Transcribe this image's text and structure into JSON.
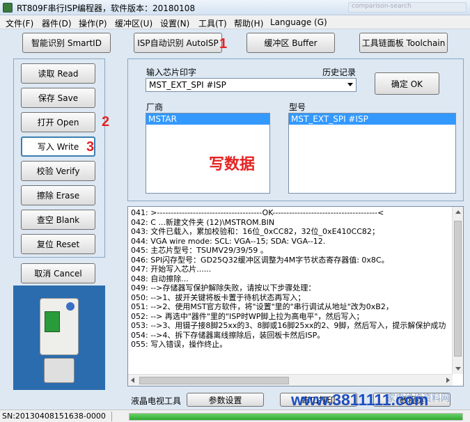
{
  "window": {
    "title": "RT809F串行ISP编程器，软件版本：20180108",
    "ghost_tab": "comparison-search"
  },
  "menu": [
    "文件(F)",
    "器件(D)",
    "操作(P)",
    "缓冲区(U)",
    "设置(N)",
    "工具(T)",
    "帮助(H)",
    "Language (G)"
  ],
  "toolbar": {
    "smartid": "智能识别 SmartID",
    "autoisp": "ISP自动识别 AutoISP",
    "buffer": "缓冲区 Buffer",
    "toolchain": "工具链面板 Toolchain"
  },
  "ops": {
    "read": "读取 Read",
    "save": "保存 Save",
    "open": "打开 Open",
    "write": "写入 Write",
    "verify": "校验 Verify",
    "erase": "擦除 Erase",
    "blank": "查空 Blank",
    "reset": "复位 Reset",
    "cancel": "取消 Cancel"
  },
  "annotations": {
    "step1": "1",
    "step2": "2",
    "step3": "3",
    "overlay": "写数据"
  },
  "chip": {
    "input_label": "输入芯片印字",
    "history_label": "历史记录",
    "input_value": "MST_EXT_SPI #ISP",
    "ok": "确定 OK",
    "vendor_label": "厂商",
    "vendor_selected": "MSTAR",
    "model_label": "型号",
    "model_selected": "MST_EXT_SPI #ISP"
  },
  "log": [
    "041:  >--------------------------------------OK--------------------------------------<",
    "042:  C                              ...新建文件夹 (12)\\MSTROM.BIN",
    "043:  文件已载入，累加校验和：16位_0xCC82，32位_0xE410CC82；",
    "044:  VGA wire mode: SCL: VGA--15; SDA: VGA--12.",
    "045:  主芯片型号：TSUMV29/39/59 。",
    "046:  SPI闪存型号：GD25Q32缓冲区调整为4M字节状态寄存器值: 0x8C。",
    "047:  开始写入芯片......",
    "048:  自动擦除...",
    "049:  -->存储器写保护解除失败，请按以下步骤处理：",
    "050:  -->1、拔开关键将板卡置于待机状态再写入；",
    "051:  -->2、使用MST官方软件，将\"设置\"里的\"串行调试从地址\"改为0xB2，",
    "052:  -->      再选中\"器件\"里的\"ISP时WP脚上拉为高电平\"，然后写入；",
    "053:  -->3、用镊子接8脚25xx的3、8脚或16脚25xx的2、9脚，然后写入，提示解保护成功",
    "054:  -->4、拆下存储器离线擦除后，装回板卡然后ISP。",
    "055:  写入错误，操作终止。"
  ],
  "bottom": {
    "lcd_label": "液晶电视工具",
    "params": "参数设置",
    "print": "串口打印",
    "tutorial": "教程页"
  },
  "status": {
    "sn": "SN:20130408151638-0000",
    "progress": 1.0
  },
  "watermark": {
    "main": "www.3811111.com",
    "sub": "家电维修资料网"
  },
  "colors": {
    "accent_red": "#e52222",
    "selection_blue": "#3399ff",
    "progress_green": "#2fa82f"
  }
}
